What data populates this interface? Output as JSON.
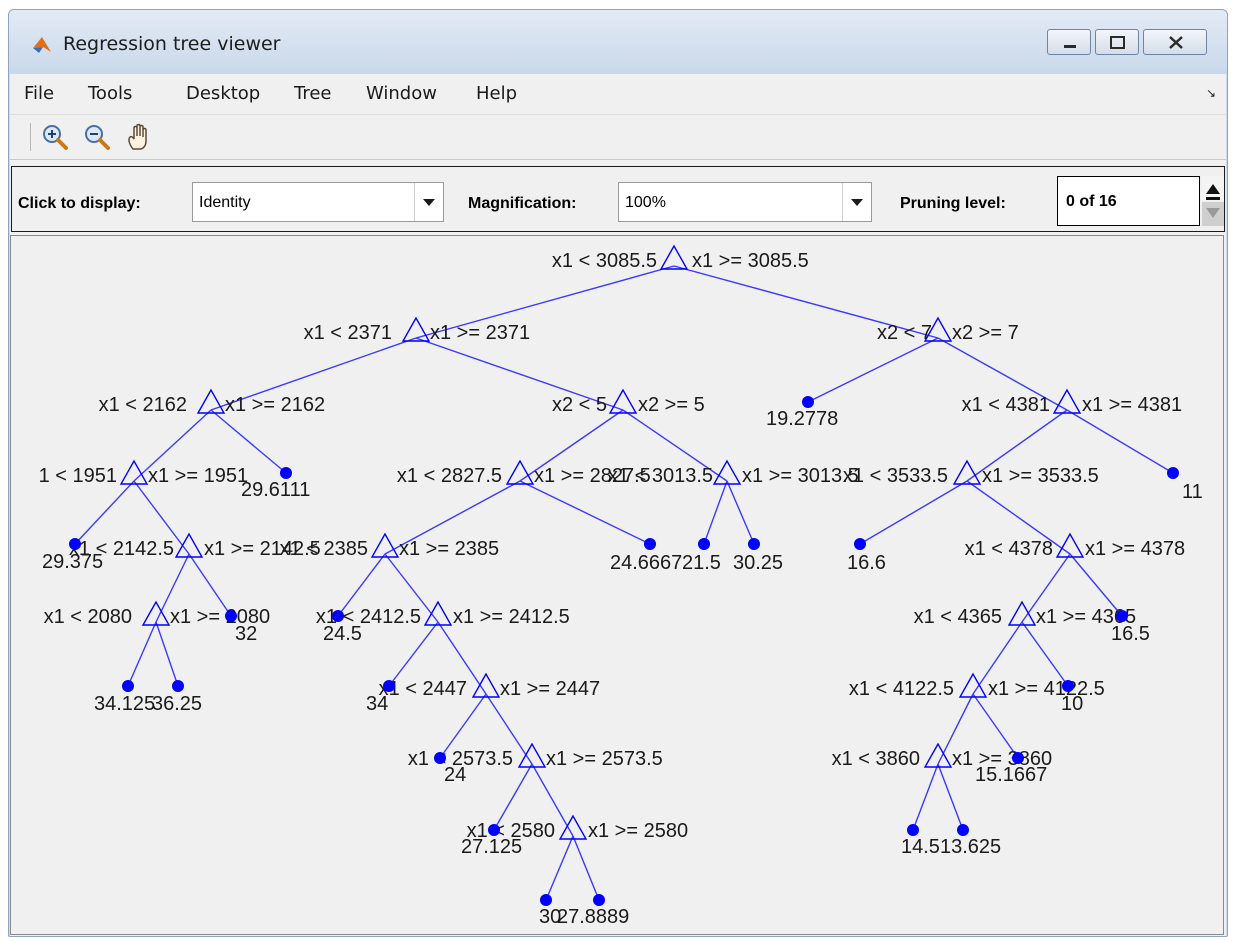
{
  "window": {
    "title": "Regression tree viewer",
    "minimize_label": "minimize",
    "maximize_label": "maximize",
    "close_label": "close"
  },
  "menu": {
    "items": [
      "File",
      "Tools",
      "Desktop",
      "Tree",
      "Window",
      "Help"
    ],
    "corner_glyph": "↘"
  },
  "toolbar": {
    "buttons": [
      "zoom-in-icon",
      "zoom-out-icon",
      "pan-hand-icon"
    ]
  },
  "controls": {
    "display_label": "Click to display:",
    "display_value": "Identity",
    "magnification_label": "Magnification:",
    "magnification_value": "100%",
    "pruning_label": "Pruning level:",
    "pruning_value": "0 of 16"
  },
  "colors": {
    "tree": "#0000ff",
    "tree_lines": "#3a3aff"
  },
  "tree": {
    "branch_nodes": [
      {
        "left": "x1 < 3085.5",
        "right": "x1 >= 3085.5"
      },
      {
        "left": "x1 < 2371",
        "right": "x1 >= 2371"
      },
      {
        "left": "x2 < 7",
        "right": "x2 >= 7"
      },
      {
        "left": "x1 < 2162",
        "right": "x1 >= 2162"
      },
      {
        "left": "x2 < 5",
        "right": "x2 >= 5"
      },
      {
        "left": "x1 < 4381",
        "right": "x1 >= 4381"
      },
      {
        "left": "1 < 1951",
        "right": "x1 >= 1951"
      },
      {
        "left": "x1 < 2827.5",
        "right": "x1 >= 2827.5"
      },
      {
        "left": "x1 < 3013.5",
        "right": "x1 >= 3013.5"
      },
      {
        "left": "x1 < 3533.5",
        "right": "x1 >= 3533.5"
      },
      {
        "left": "x1 < 2142.5",
        "right": "x1 >= 2142.5"
      },
      {
        "left": "x1 < 2385",
        "right": "x1 >= 2385"
      },
      {
        "left": "x1 < 4378",
        "right": "x1 >= 4378"
      },
      {
        "left": "x1 < 2080",
        "right": "x1 >= 2080"
      },
      {
        "left": "x1 < 2412.5",
        "right": "x1 >= 2412.5"
      },
      {
        "left": "x1 < 4365",
        "right": "x1 >= 4365"
      },
      {
        "left": "x1 < 2447",
        "right": "x1 >= 2447"
      },
      {
        "left": "x1 < 4122.5",
        "right": "x1 >= 4122.5"
      },
      {
        "left": "x1 < 2573.5",
        "right": "x1 >= 2573.5"
      },
      {
        "left": "x1 < 3860",
        "right": "x1 >= 3860"
      },
      {
        "left": "x1 < 2580",
        "right": "x1 >= 2580"
      }
    ],
    "leaves": [
      "19.2778",
      "11",
      "29.6111",
      "24.6667",
      "21.5",
      "30.25",
      "16.6",
      "29.375",
      "32",
      "24.5",
      "16.5",
      "34.125",
      "36.25",
      "34",
      "10",
      "24",
      "15.1667",
      "27.125",
      "14.5",
      "13.625",
      "30",
      "27.8889"
    ]
  }
}
